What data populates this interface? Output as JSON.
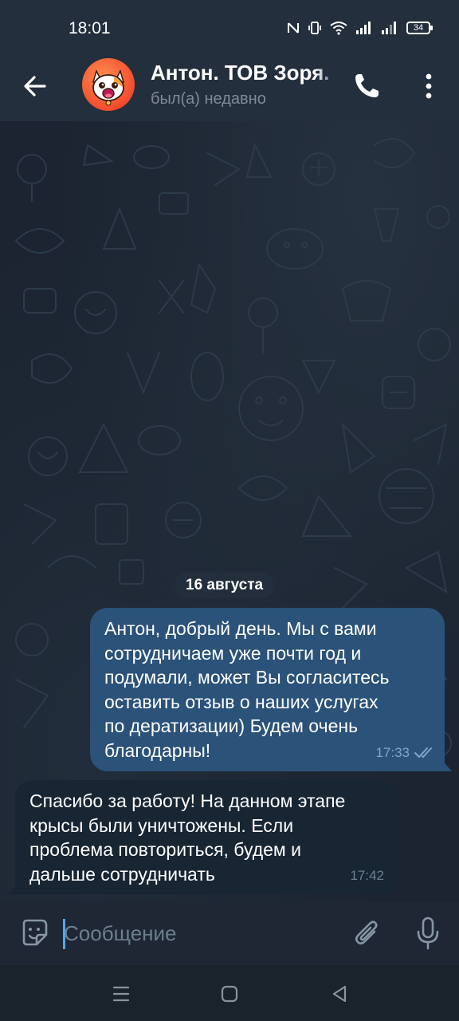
{
  "status_bar": {
    "time": "18:01",
    "battery": "34",
    "icons": [
      "nfc-icon",
      "vibrate-icon",
      "wifi-icon",
      "signal-icon",
      "signal-icon",
      "battery-icon"
    ]
  },
  "header": {
    "title": "Антон. ТОВ Зоря.",
    "status": "был(а) недавно",
    "icons": [
      "back-arrow-icon",
      "phone-icon",
      "more-vert-icon"
    ]
  },
  "chat": {
    "date_label": "16 августа",
    "messages": [
      {
        "direction": "outgoing",
        "text": "Антон, добрый день. Мы с вами\nсотрудничаем уже почти год и\nподумали, может Вы согласитесь\nоставить отзыв о наших услугах\nпо дератизации) Будем очень\nблагодарны!",
        "time": "17:33",
        "read": true
      },
      {
        "direction": "incoming",
        "text": "Спасибо за работу! На данном этапе\nкрысы были уничтожены. Если\nпроблема повториться, будем и\nдальше сотрудничать",
        "time": "17:42"
      }
    ]
  },
  "input": {
    "placeholder": "Сообщение",
    "value": "",
    "icons": [
      "sticker-icon",
      "attach-icon",
      "mic-icon"
    ]
  },
  "nav": {
    "icons": [
      "recents-icon",
      "home-icon",
      "back-icon"
    ]
  },
  "colors": {
    "header_bg": "#242f3d",
    "chat_bg": "#1b2430",
    "outgoing_bubble": "#2b5278",
    "incoming_bubble": "#182533",
    "accent": "#5aa5e6"
  }
}
